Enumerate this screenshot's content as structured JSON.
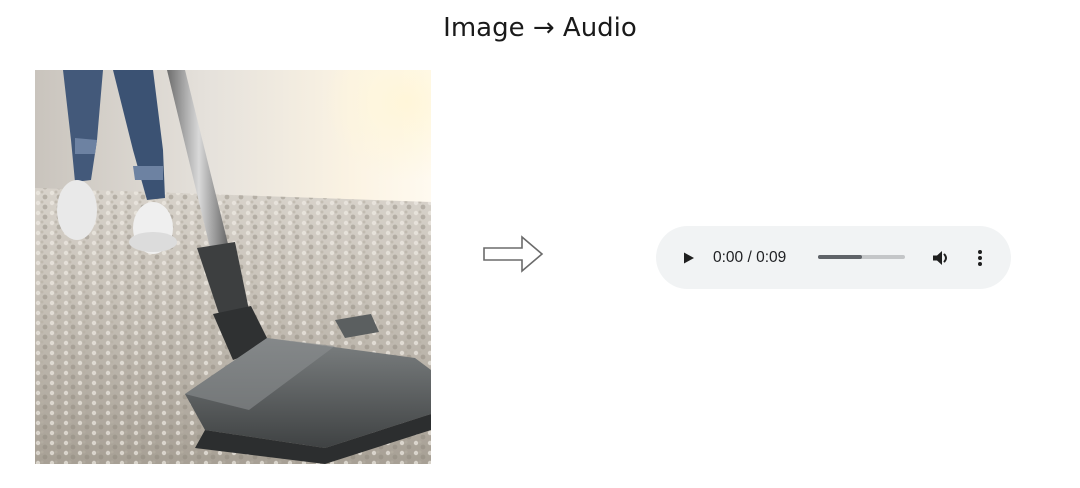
{
  "header": {
    "title": "Image → Audio"
  },
  "image": {
    "subject": "vacuum cleaner on shaggy carpet"
  },
  "arrow_icon": "right-outline-arrow-icon",
  "audio_player": {
    "current_time": "0:00",
    "duration": "0:09",
    "time_display": "0:00 / 0:09",
    "progress_fraction": 0.5,
    "icons": {
      "play": "play-icon",
      "volume": "volume-icon",
      "menu": "more-vert-icon"
    },
    "background_color": "#f1f3f4",
    "track_color": "#c4c6c8",
    "fill_color": "#5f6368"
  }
}
